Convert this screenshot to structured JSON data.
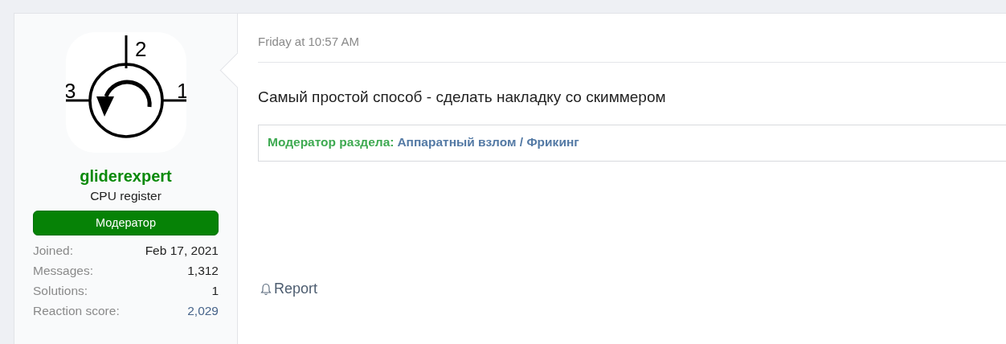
{
  "user": {
    "avatar_labels": [
      "2",
      "3",
      "1"
    ],
    "name": "gliderexpert",
    "title": "CPU register",
    "banner": "Модератор",
    "stats": [
      {
        "label": "Joined:",
        "value": "Feb 17, 2021",
        "kind": "plain"
      },
      {
        "label": "Messages:",
        "value": "1,312",
        "kind": "plain"
      },
      {
        "label": "Solutions:",
        "value": "1",
        "kind": "plain"
      },
      {
        "label": "Reaction score:",
        "value": "2,029",
        "kind": "link"
      }
    ]
  },
  "post": {
    "date": "Friday at 10:57 AM",
    "body": "Самый простой способ - сделать накладку со скиммером",
    "signature": {
      "label": "Модератор раздела:",
      "link": "Аппаратный взлом / Фрикинг"
    },
    "actions": [
      "Report"
    ]
  }
}
